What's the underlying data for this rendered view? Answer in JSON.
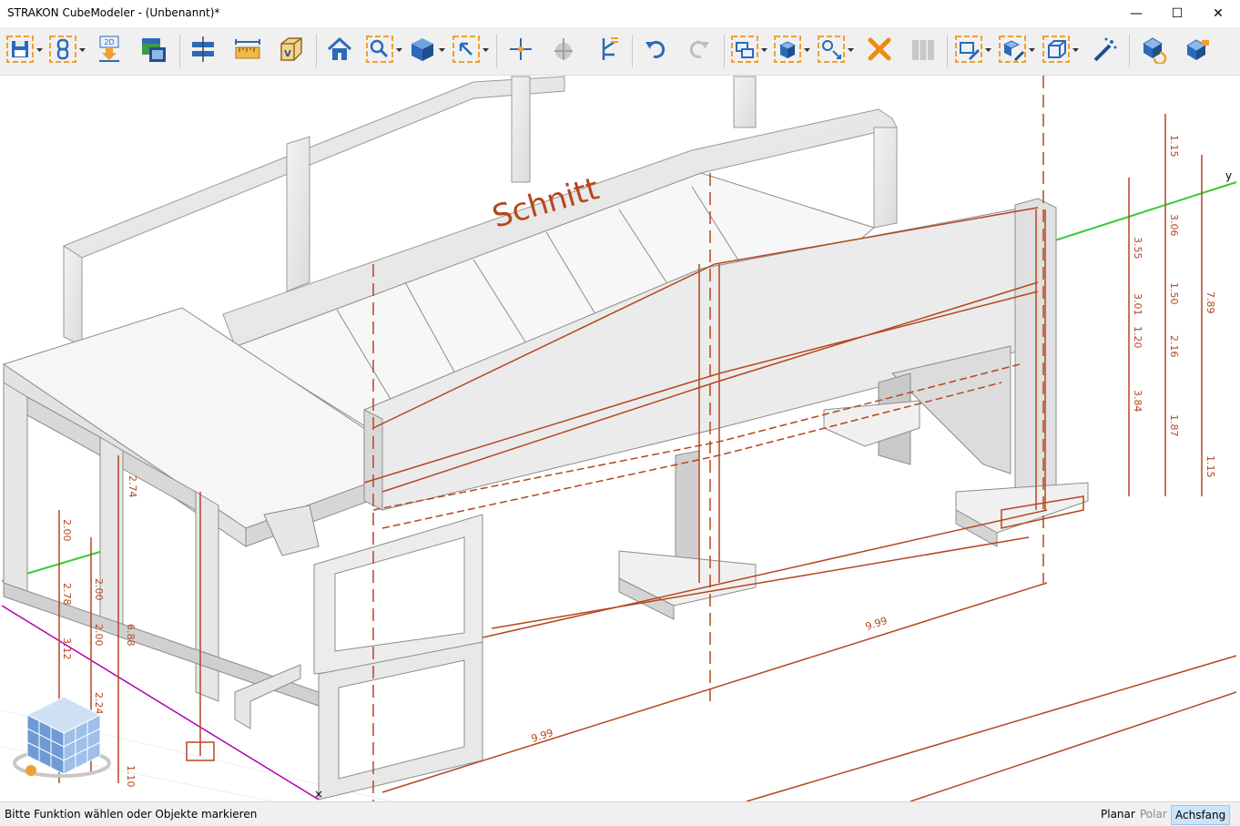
{
  "window": {
    "title": "STRAKON CubeModeler - (Unbenannt)*",
    "minimize_glyph": "—",
    "maximize_glyph": "☐",
    "close_glyph": "✕"
  },
  "toolbar": {
    "items": [
      {
        "icon": "save-icon",
        "dropdown": true
      },
      {
        "icon": "link-icon",
        "dropdown": true
      },
      {
        "icon": "2d-import-icon",
        "label": "2D"
      },
      {
        "icon": "image-export-icon"
      },
      {
        "icon": "align-icon"
      },
      {
        "icon": "measure-icon"
      },
      {
        "icon": "view-cube-v-icon",
        "label": "V"
      },
      {
        "icon": "home-icon"
      },
      {
        "icon": "zoom-icon",
        "dropdown": true
      },
      {
        "icon": "solid-view-icon",
        "dropdown": true
      },
      {
        "icon": "select-icon",
        "dropdown": true
      },
      {
        "icon": "axis-icon"
      },
      {
        "icon": "snap-disabled-icon"
      },
      {
        "icon": "branch-icon"
      },
      {
        "icon": "undo-icon"
      },
      {
        "icon": "redo-icon"
      },
      {
        "icon": "object-select-icon",
        "dropdown": true
      },
      {
        "icon": "group-select-icon",
        "dropdown": true
      },
      {
        "icon": "transform-icon",
        "dropdown": true
      },
      {
        "icon": "delete-icon"
      },
      {
        "icon": "wall-icon"
      },
      {
        "icon": "edit-object-icon",
        "dropdown": true
      },
      {
        "icon": "edit-group-icon",
        "dropdown": true
      },
      {
        "icon": "box-icon",
        "dropdown": true
      },
      {
        "icon": "magic-wand-icon"
      },
      {
        "icon": "rotate-view-icon"
      },
      {
        "icon": "settings-icon"
      }
    ]
  },
  "viewport": {
    "section_label": "Schnitt",
    "axis_label": "y",
    "dimensions": [
      "9.99",
      "9.99",
      "1.15",
      "3.06",
      "3.55",
      "7.89",
      "1.50",
      "3.01",
      "1.20",
      "2.16",
      "3.84",
      "1.87",
      "1.15",
      "2.00",
      "2.78",
      "2.00",
      "6.88",
      "2.24",
      "2.74",
      "3.12",
      "2.00",
      "1.10"
    ],
    "colors": {
      "dimension": "#b5461e",
      "axis_green": "#33cc33",
      "axis_magenta": "#b000b0",
      "structure": "#e8e8e8"
    }
  },
  "status": {
    "message": "Bitte Funktion wählen oder Objekte markieren",
    "modes": [
      {
        "label": "Planar",
        "active": false,
        "disabled": false
      },
      {
        "label": "Polar",
        "active": false,
        "disabled": true
      },
      {
        "label": "Achsfang",
        "active": true,
        "disabled": false
      }
    ]
  }
}
